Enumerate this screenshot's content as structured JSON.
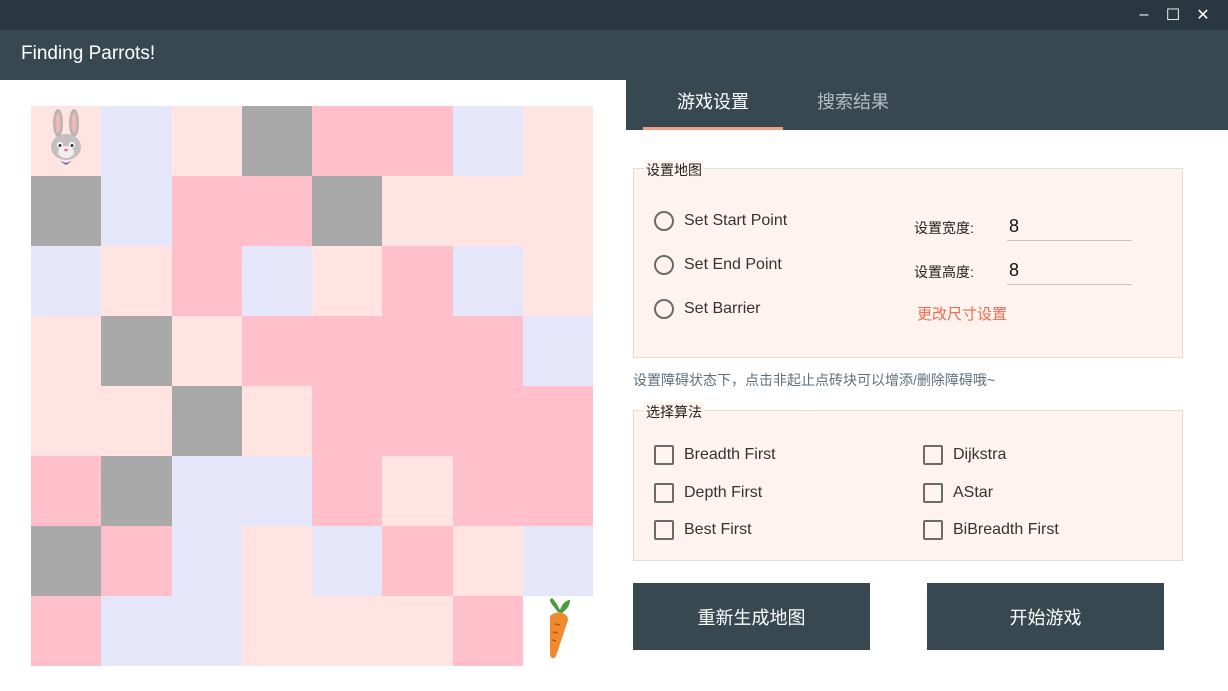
{
  "window": {
    "title": "Finding Parrots!",
    "controls": [
      {
        "name": "minimize-button",
        "symbol": "–"
      },
      {
        "name": "maximize-button",
        "symbol": "☐"
      },
      {
        "name": "close-button",
        "symbol": "✕"
      }
    ]
  },
  "board": {
    "rows": 8,
    "cols": 8,
    "colors": {
      "P": "#ffc0cb",
      "L": "#e6e6fa",
      "R": "#ffe4e1",
      "G": "#a9a9a9",
      "W": "#ffffff"
    },
    "cells": [
      [
        "R",
        "L",
        "R",
        "G",
        "P",
        "P",
        "L",
        "R"
      ],
      [
        "G",
        "L",
        "P",
        "P",
        "G",
        "R",
        "R",
        "R"
      ],
      [
        "L",
        "R",
        "P",
        "L",
        "R",
        "P",
        "L",
        "R"
      ],
      [
        "R",
        "G",
        "R",
        "P",
        "P",
        "P",
        "P",
        "L"
      ],
      [
        "R",
        "R",
        "G",
        "R",
        "P",
        "P",
        "P",
        "P"
      ],
      [
        "P",
        "G",
        "L",
        "L",
        "P",
        "R",
        "P",
        "P"
      ],
      [
        "G",
        "P",
        "L",
        "R",
        "L",
        "P",
        "R",
        "L"
      ],
      [
        "P",
        "L",
        "L",
        "R",
        "R",
        "R",
        "P",
        "W"
      ]
    ],
    "start": {
      "row": 0,
      "col": 0,
      "icon": "rabbit-icon"
    },
    "end": {
      "row": 7,
      "col": 7,
      "icon": "carrot-icon"
    }
  },
  "tabs": [
    {
      "label": "游戏设置",
      "active": true
    },
    {
      "label": "搜索结果",
      "active": false
    }
  ],
  "map_settings": {
    "group_title": "设置地图",
    "radio_options": [
      "Set Start Point",
      "Set End Point",
      "Set Barrier"
    ],
    "width_label": "设置宽度:",
    "width_value": "8",
    "height_label": "设置高度:",
    "height_value": "8",
    "apply_link": "更改尺寸设置"
  },
  "hint": "设置障碍状态下，点击非起止点砖块可以增添/删除障碍哦~",
  "algorithms": {
    "group_title": "选择算法",
    "options": [
      "Breadth First",
      "Dijkstra",
      "Depth First",
      "AStar",
      "Best First",
      "BiBreadth First"
    ]
  },
  "buttons": {
    "regenerate": "重新生成地图",
    "start_game": "开始游戏"
  },
  "theme": {
    "dark": "#384850",
    "darker": "#293740",
    "accent": "#ef9e88",
    "link": "#ef6a4e",
    "panel": "#fff3f0"
  }
}
